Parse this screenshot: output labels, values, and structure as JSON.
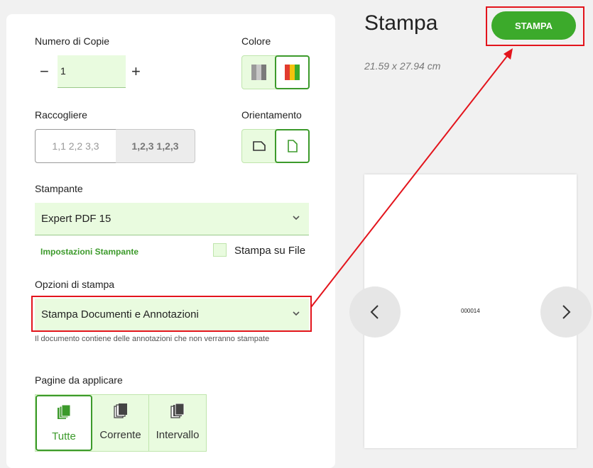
{
  "copies": {
    "label": "Numero di Copie",
    "minus": "−",
    "value": "1",
    "plus": "+"
  },
  "color": {
    "label": "Colore",
    "options": [
      "grayscale-icon",
      "color-icon"
    ],
    "selected": "color-icon"
  },
  "collate": {
    "label": "Raccogliere",
    "option_a": "1,1 2,2 3,3",
    "option_b": "1,2,3 1,2,3"
  },
  "orientation": {
    "label": "Orientamento",
    "options": [
      "landscape-icon",
      "portrait-icon"
    ],
    "selected": "portrait-icon"
  },
  "printer": {
    "label": "Stampante",
    "value": "Expert PDF 15",
    "settings_link": "Impostazioni Stampante",
    "print_to_file": "Stampa su File"
  },
  "print_options": {
    "label": "Opzioni di stampa",
    "value": "Stampa Documenti e Annotazioni",
    "note": "Il documento contiene delle annotazioni che non verranno stampate"
  },
  "pages": {
    "label": "Pagine da applicare",
    "items": [
      "Tutte",
      "Corrente",
      "Intervallo"
    ],
    "selected": "Tutte"
  },
  "header": {
    "title": "Stampa",
    "print_button": "STAMPA",
    "dimensions": "21.59 x 27.94 cm"
  },
  "preview": {
    "page_number": "000014"
  },
  "colors": {
    "accent": "#3caa2b",
    "field_bg": "#e9fbdf",
    "highlight": "#e3141c"
  }
}
